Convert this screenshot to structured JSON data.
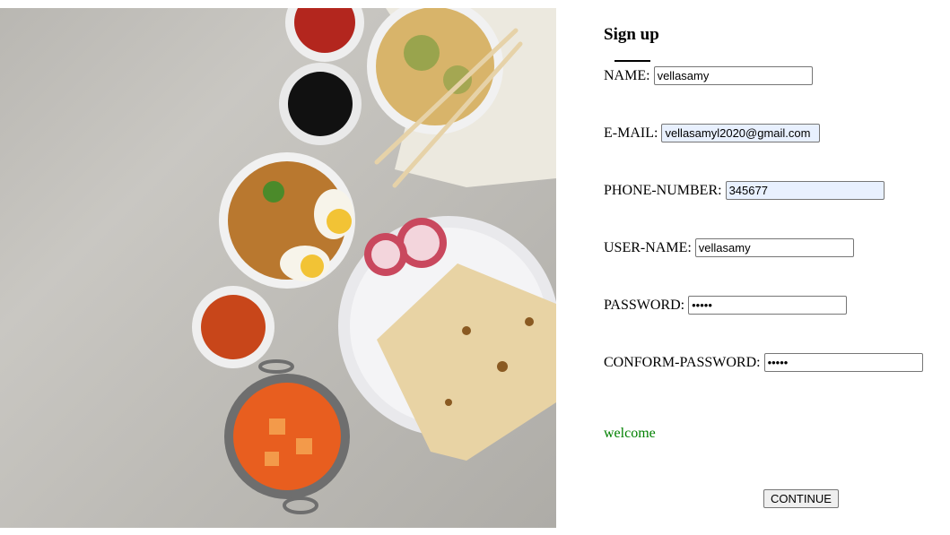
{
  "form": {
    "title": "Sign up",
    "fields": [
      {
        "label": "NAME:",
        "value": "vellasamy"
      },
      {
        "label": "E-MAIL:",
        "value": "vellasamyl2020@gmail.com"
      },
      {
        "label": "PHONE-NUMBER:",
        "value": "345677"
      },
      {
        "label": "USER-NAME:",
        "value": "vellasamy"
      },
      {
        "label": "PASSWORD:",
        "value": "•••••"
      },
      {
        "label": "CONFORM-PASSWORD:",
        "value": "•••••"
      }
    ],
    "message": "welcome",
    "continue_label": "CONTINUE"
  },
  "colors": {
    "message": "#008000",
    "autofill_bg": "#e8f0fe"
  }
}
